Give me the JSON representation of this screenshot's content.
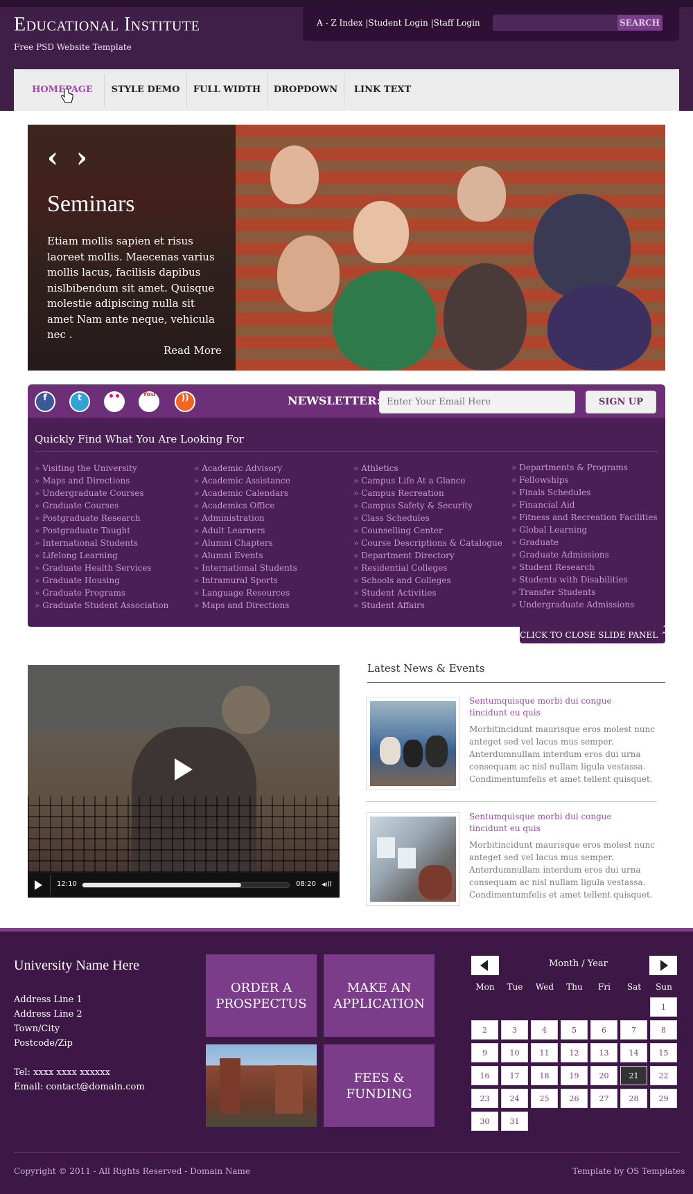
{
  "header": {
    "title": "Educational Institute",
    "subtitle": "Free PSD Website Template",
    "util_links": [
      "A - Z Index",
      "Student Login",
      "Staff Login"
    ],
    "util_sep": "|",
    "search_placeholder": "",
    "search_button": "SEARCH"
  },
  "nav": {
    "items": [
      "HOMEPAGE",
      "STYLE DEMO",
      "FULL WIDTH",
      "DROPDOWN",
      "LINK TEXT"
    ],
    "active_color": "#9b4aa8"
  },
  "hero": {
    "arrows": "‹ ›",
    "title": "Seminars",
    "text": "Etiam mollis sapien et risus laoreet mollis. Maecenas varius mollis lacus, facilisis dapibus nislbibendum sit amet. Quisque molestie adipiscing nulla sit amet Nam ante neque, vehicula nec .",
    "read_more": "Read More"
  },
  "social": {
    "icons": [
      "facebook-icon",
      "twitter-icon",
      "flickr-icon",
      "youtube-icon",
      "rss-icon"
    ],
    "icon_glyphs": [
      "f",
      "t",
      "••",
      "You",
      "))"
    ],
    "newsletter_label": "NEWSLETTER:",
    "newsletter_placeholder": "Enter Your Email Here",
    "signup_label": "SIGN UP"
  },
  "quick_links": {
    "title": "Quickly Find What You Are Looking For",
    "columns": [
      [
        "Visiting the University",
        "Maps and Directions",
        "Undergraduate Courses",
        "Graduate Courses",
        "Postgraduate Research",
        "Postgraduate Taught",
        "International Students",
        "Lifelong Learning",
        "Graduate Health Services",
        "Graduate Housing",
        "Graduate Programs",
        "Graduate Student Association"
      ],
      [
        "Academic Advisory",
        "Academic Assistance",
        "Academic Calendars",
        "Academics Office",
        "Administration",
        "Adult Learners",
        "Alumni Chapters",
        "Alumni Events",
        "International Students",
        "Intramural Sports",
        "Language Resources",
        "Maps and Directions"
      ],
      [
        "Athletics",
        "Campus Life At a Glance",
        "Campus Recreation",
        "Campus Safety & Security",
        "Class Schedules",
        "Counselling Center",
        "Course Descriptions & Catalogue",
        "Department Directory",
        "Residential Colleges",
        "Schools and Colleges",
        "Student Activities",
        "Student Affairs"
      ],
      [
        "Departments & Programs",
        "Fellowships",
        "Finals Schedules",
        "Financial Aid",
        "Fitness and Recreation Facilities",
        "Global Learning",
        "Graduate",
        "Graduate Admissions",
        "Student Research",
        "Students with Disabilities",
        "Transfer Students",
        "Undergraduate Admissions"
      ]
    ],
    "close_label": "CLICK TO CLOSE SLIDE PANEL"
  },
  "video": {
    "elapsed": "12:10",
    "remaining": "08:20",
    "progress": 0.77
  },
  "news": {
    "title": "Latest News & Events",
    "items": [
      {
        "headline": "Sentumquisque morbi dui congue tincidunt eu quis",
        "body": "Morbitincidunt maurisque eros molest nunc anteget sed vel lacus mus semper. Anterdumnullam interdum eros dui urna consequam ac nisl nullam ligula vestassa. Condimentumfelis et amet tellent quisquet."
      },
      {
        "headline": "Sentumquisque morbi dui congue tincidunt eu quis",
        "body": "Morbitincidunt maurisque eros molest nunc anteget sed vel lacus mus semper. Anterdumnullam interdum eros dui urna consequam ac nisl nullam ligula vestassa. Condimentumfelis et amet tellent quisquet."
      }
    ]
  },
  "footer": {
    "university": "University Name Here",
    "address": [
      "Address Line 1",
      "Address Line 2",
      "Town/City",
      "Postcode/Zip"
    ],
    "tel": "Tel: xxxx xxxx xxxxxx",
    "email": "Email: contact@domain.com",
    "boxes": [
      "ORDER A PROSPECTUS",
      "MAKE AN APPLICATION",
      "FEES & FUNDING"
    ],
    "copyright": "Copyright © 2011 - All Rights Reserved - Domain Name",
    "template_by": "Template by OS Templates"
  },
  "calendar": {
    "title": "Month / Year",
    "days_of_week": [
      "Mon",
      "Tue",
      "Wed",
      "Thu",
      "Fri",
      "Sat",
      "Sun"
    ],
    "first_weekday_index": 6,
    "days": 31,
    "today": 21
  }
}
